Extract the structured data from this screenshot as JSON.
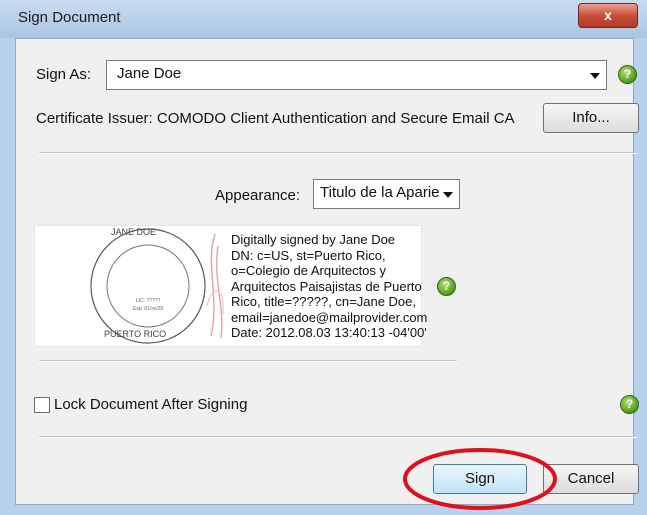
{
  "window": {
    "title": "Sign Document",
    "close_glyph": "x"
  },
  "sign_as": {
    "label": "Sign As:",
    "value": "Jane  Doe"
  },
  "certificate": {
    "issuer_text": "Certificate Issuer: COMODO Client Authentication and Secure Email CA",
    "info_button": "Info..."
  },
  "appearance": {
    "label": "Appearance:",
    "value": "Titulo de la Aparie"
  },
  "stamp": {
    "top_text": "JANE DOE",
    "bottom_text": "PUERTO RICO",
    "lic_text": "LIC. ?????",
    "exp_text": "Exp. 01/xx/20"
  },
  "signature_details": {
    "lines": [
      "Digitally signed by Jane  Doe",
      "DN: c=US, st=Puerto Rico,",
      "o=Colegio de Arquitectos y",
      "Arquitectos Paisajistas de Puerto",
      "Rico, title=?????, cn=Jane  Doe,",
      "email=janedoe@mailprovider.com",
      "Date: 2012.08.03 13:40:13 -04'00'"
    ]
  },
  "lock": {
    "label": "Lock Document After Signing",
    "checked": false
  },
  "buttons": {
    "sign": "Sign",
    "cancel": "Cancel"
  },
  "icons": {
    "help": "help-icon",
    "help_glyph": "?"
  },
  "colors": {
    "highlight_ring": "#e0101a",
    "help_green": "#4f9a1c"
  }
}
